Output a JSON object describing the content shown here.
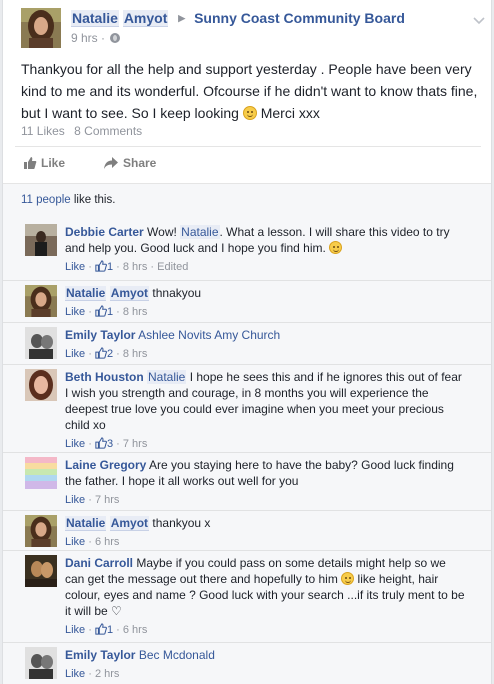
{
  "post": {
    "author": "Natalie",
    "author_last": "Amyot",
    "group": "Sunny Coast Community Board",
    "time": "9 hrs",
    "separator": " · ",
    "text": "Thankyou for all the help and support yesterday . People have been very kind to me and its wonderful. Ofcourse if he didn't want to know thats fine, but I want to see. So I keep looking ",
    "text_end": " Merci xxx",
    "likes_count": "11 Likes",
    "comments_count": "8 Comments"
  },
  "actions": {
    "like": "Like",
    "share": "Share"
  },
  "likes_bar": {
    "people": "11 people",
    "rest": " like this."
  },
  "comments": [
    {
      "name": "Debbie Carter",
      "pre": " Wow! ",
      "tag": "Natalie",
      "text": ". What a lesson. I will share this video to try and help you. Good luck and I hope you find him. ",
      "like": "Like",
      "dot": " · ",
      "count": "1",
      "time": "8 hrs",
      "edited": "Edited"
    },
    {
      "name": "Natalie",
      "name_last": "Amyot",
      "text": " thnakyou",
      "like": "Like",
      "dot": " · ",
      "count": "1",
      "time": "8 hrs"
    },
    {
      "name": "Emily Taylor",
      "tag": "Ashlee Novits",
      "tag2": "Amy Church",
      "like": "Like",
      "dot": " · ",
      "count": "2",
      "time": "8 hrs"
    },
    {
      "name": "Beth Houston",
      "tag": "Natalie",
      "text": " I hope he sees this and if he ignores this out of fear I wish you strength and courage, in 8 months you will experience the deepest true love you could ever imagine when you meet your precious child xo",
      "like": "Like",
      "dot": " · ",
      "count": "3",
      "time": "7 hrs"
    },
    {
      "name": "Laine Gregory",
      "text": " Are you staying here to have the baby? Good luck finding the father. I hope it all works out well for you",
      "like": "Like",
      "dot": " · ",
      "time": "7 hrs"
    },
    {
      "name": "Natalie",
      "name_last": "Amyot",
      "text": " thankyou x",
      "like": "Like",
      "dot": " · ",
      "time": "6 hrs"
    },
    {
      "name": "Dani Carroll",
      "text": " Maybe if you could pass on some details might help so we can get the message out there and hopefully to him ",
      "text2": " like height, hair colour, eyes and name ? Good luck with your search ...if its truly ment to be it will be ",
      "heart": "♡",
      "like": "Like",
      "dot": " · ",
      "count": "1",
      "time": "6 hrs"
    },
    {
      "name": "Emily Taylor",
      "tag": "Bec Mcdonald",
      "like": "Like",
      "dot": " · ",
      "time": "2 hrs"
    }
  ],
  "icons": {
    "thumb": "thumbs-up-icon",
    "share": "share-arrow-icon",
    "globe": "globe-icon",
    "chevron": "chevron-down-icon",
    "smile": "smile-emoji-icon"
  },
  "colors": {
    "link": "#365899",
    "meta": "#90949c",
    "bg": "#f6f7f9"
  }
}
